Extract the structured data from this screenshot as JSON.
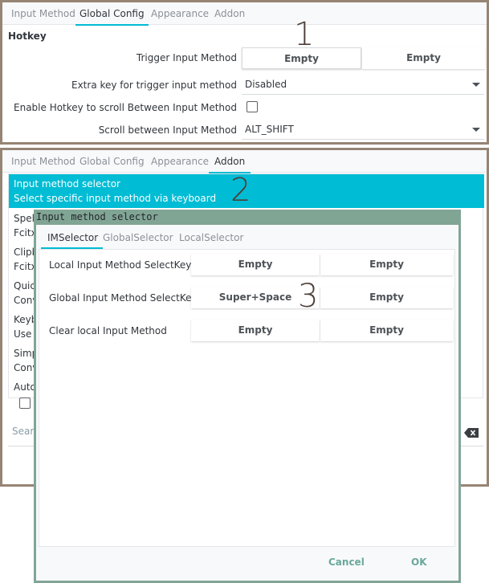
{
  "panel1": {
    "tabs": [
      {
        "label": "Input Method",
        "active": false
      },
      {
        "label": "Global Config",
        "active": true
      },
      {
        "label": "Appearance",
        "active": false
      },
      {
        "label": "Addon",
        "active": false
      }
    ],
    "section_title": "Hotkey",
    "annotation": "1",
    "rows": {
      "trigger": {
        "label": "Trigger Input Method",
        "key1": "Empty",
        "key2": "Empty"
      },
      "extra_key": {
        "label": "Extra key for trigger input method",
        "value": "Disabled"
      },
      "enable_scroll": {
        "label": "Enable Hotkey to scroll Between Input Method",
        "checked": false
      },
      "scroll": {
        "label": "Scroll between Input Method",
        "value": "ALT_SHIFT"
      }
    }
  },
  "panel2": {
    "tabs": [
      {
        "label": "Input Method",
        "active": false
      },
      {
        "label": "Global Config",
        "active": false
      },
      {
        "label": "Appearance",
        "active": false
      },
      {
        "label": "Addon",
        "active": true
      }
    ],
    "annotation": "2",
    "selected_item": {
      "title": "Input method selector",
      "description": "Select specific input method via keyboard"
    },
    "items": [
      {
        "title": "Spell",
        "description": "Fcitx"
      },
      {
        "title": "Clipb",
        "description": "Fcitx"
      },
      {
        "title": "Quick",
        "description": "Conv"
      },
      {
        "title": "Keyb",
        "description": "Use K"
      },
      {
        "title": "Simp",
        "description": "Conv"
      },
      {
        "title": "Auto",
        "description": ""
      }
    ],
    "search_placeholder": "Search",
    "advanced_checked": false,
    "icons": {
      "clear": "backspace-clear-icon"
    }
  },
  "dialog": {
    "title": "Input method selector",
    "annotation": "3",
    "tabs": [
      {
        "label": "IMSelector",
        "active": true
      },
      {
        "label": "GlobalSelector",
        "active": false
      },
      {
        "label": "LocalSelector",
        "active": false
      }
    ],
    "rows": [
      {
        "label": "Local Input Method SelectKey",
        "key1": "Empty",
        "key2": "Empty"
      },
      {
        "label": "Global Input Method SelectKey",
        "key1": "Super+Space",
        "key2": "Empty"
      },
      {
        "label": "Clear local Input Method",
        "key1": "Empty",
        "key2": "Empty"
      }
    ],
    "buttons": {
      "cancel": "Cancel",
      "ok": "OK"
    }
  },
  "colors": {
    "accent": "#00bcd4",
    "frame_border": "#968474",
    "dialog_border": "#81a595",
    "dialog_button_text": "#6aa89b"
  }
}
